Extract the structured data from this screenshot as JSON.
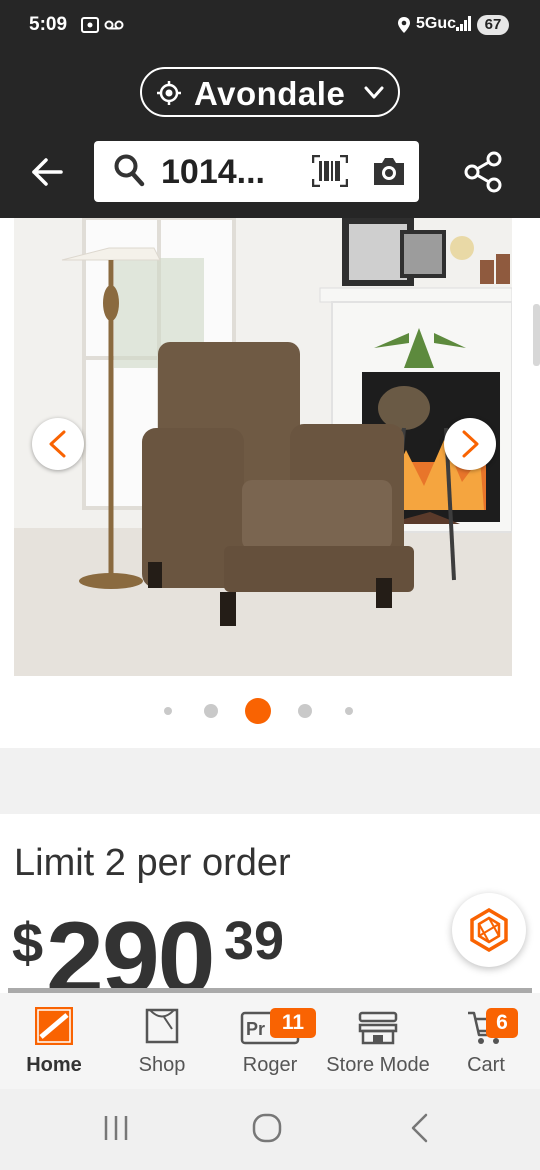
{
  "status_bar": {
    "time": "5:09",
    "network": "5Guc",
    "battery": "67"
  },
  "header": {
    "location": "Avondale",
    "search_query": "1014...",
    "icons": [
      "back-arrow-icon",
      "search-icon",
      "barcode-icon",
      "camera-icon",
      "share-icon",
      "location-pin-icon",
      "chevron-down-icon"
    ]
  },
  "gallery": {
    "image_count": 5,
    "active_index": 2,
    "accent": "#f96302"
  },
  "product": {
    "limit_text": "Limit 2 per order",
    "price_dollar": "$",
    "price_whole": "290",
    "price_cents": "39"
  },
  "bottom_nav": [
    {
      "id": "home",
      "label": "Home",
      "badge": null,
      "active": true
    },
    {
      "id": "shop",
      "label": "Shop",
      "badge": null,
      "active": false
    },
    {
      "id": "pro",
      "label": "Roger",
      "badge": "11",
      "active": false
    },
    {
      "id": "store-mode",
      "label": "Store Mode",
      "badge": null,
      "active": false
    },
    {
      "id": "cart",
      "label": "Cart",
      "badge": "6",
      "active": false
    }
  ],
  "colors": {
    "header_bg": "#262626",
    "accent": "#f96302",
    "text": "#333333"
  }
}
